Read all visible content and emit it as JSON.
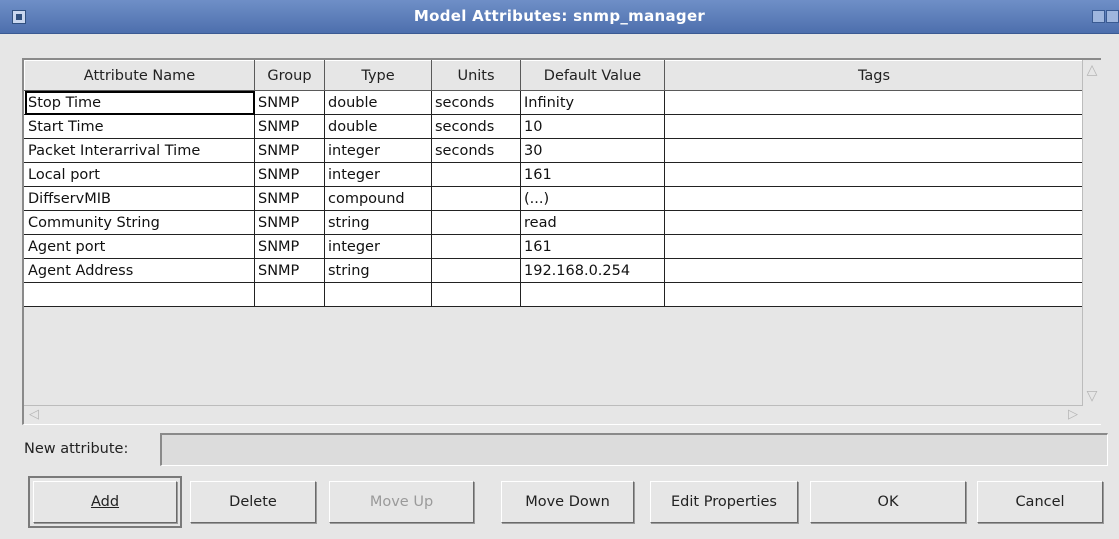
{
  "window": {
    "title": "Model Attributes: snmp_manager"
  },
  "table": {
    "columns": [
      "Attribute Name",
      "Group",
      "Type",
      "Units",
      "Default Value",
      "Tags"
    ],
    "rows": [
      [
        "Stop Time",
        "SNMP",
        "double",
        "seconds",
        "Infinity",
        ""
      ],
      [
        "Start Time",
        "SNMP",
        "double",
        "seconds",
        "10",
        ""
      ],
      [
        "Packet Interarrival Time",
        "SNMP",
        "integer",
        "seconds",
        "30",
        ""
      ],
      [
        "Local port",
        "SNMP",
        "integer",
        "",
        "161",
        ""
      ],
      [
        "DiffservMIB",
        "SNMP",
        "compound",
        "",
        "(...)",
        ""
      ],
      [
        "Community String",
        "SNMP",
        "string",
        "",
        "read",
        ""
      ],
      [
        "Agent port",
        "SNMP",
        "integer",
        "",
        "161",
        ""
      ],
      [
        "Agent Address",
        "SNMP",
        "string",
        "",
        "192.168.0.254",
        ""
      ],
      [
        "",
        "",
        "",
        "",
        "",
        ""
      ]
    ]
  },
  "new_attribute": {
    "label": "New attribute:",
    "value": ""
  },
  "buttons": {
    "add": "Add",
    "delete": "Delete",
    "move_up": "Move Up",
    "move_down": "Move Down",
    "edit_properties": "Edit Properties",
    "ok": "OK",
    "cancel": "Cancel"
  }
}
